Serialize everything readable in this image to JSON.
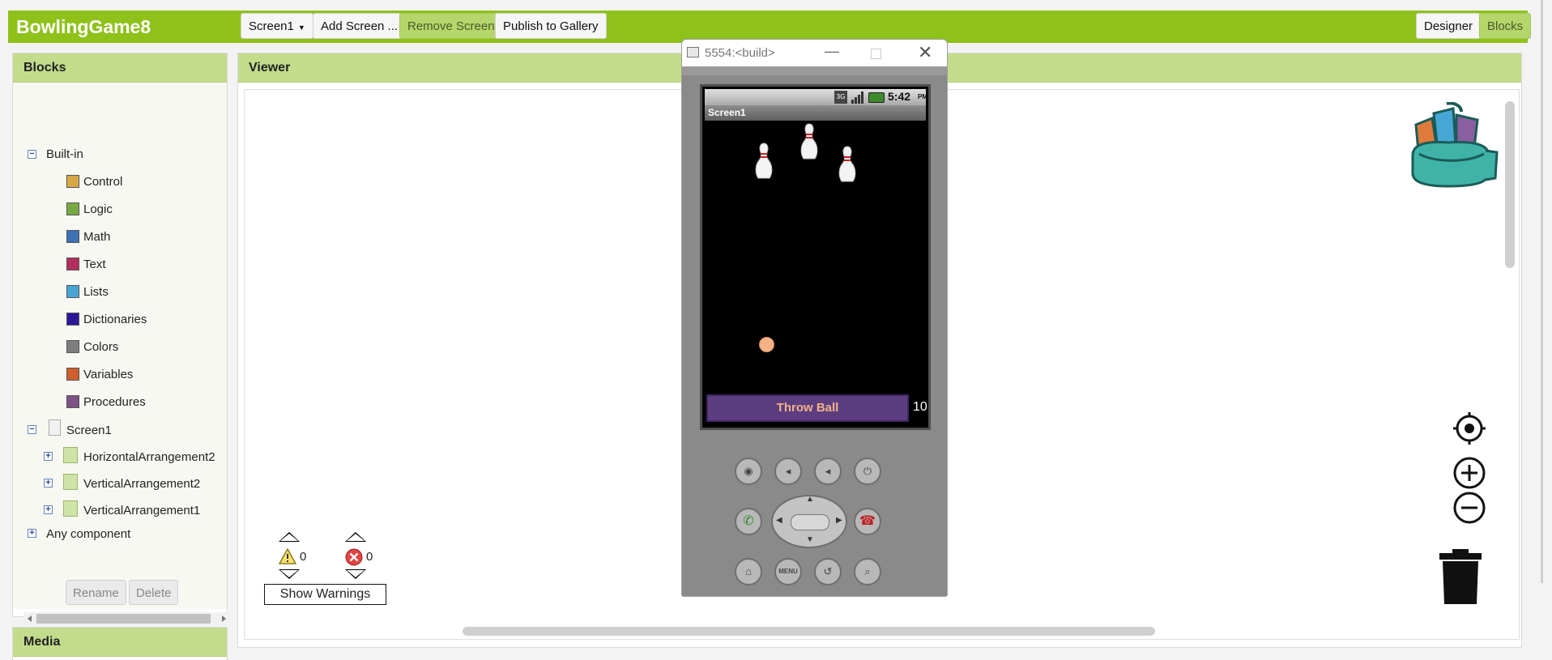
{
  "app": {
    "title": "BowlingGame8"
  },
  "toolbar": {
    "screen_select": "Screen1",
    "add_screen": "Add Screen ...",
    "remove_screen": "Remove Screen",
    "publish": "Publish to Gallery",
    "designer": "Designer",
    "blocks": "Blocks"
  },
  "blocks_panel": {
    "title": "Blocks",
    "builtin_label": "Built-in",
    "builtin": [
      {
        "label": "Control",
        "color": "#d7a745"
      },
      {
        "label": "Logic",
        "color": "#77ab41"
      },
      {
        "label": "Math",
        "color": "#3f71b5"
      },
      {
        "label": "Text",
        "color": "#b32d5e"
      },
      {
        "label": "Lists",
        "color": "#49a6d4"
      },
      {
        "label": "Dictionaries",
        "color": "#2d1799"
      },
      {
        "label": "Colors",
        "color": "#7d7d7d"
      },
      {
        "label": "Variables",
        "color": "#d05f2d"
      },
      {
        "label": "Procedures",
        "color": "#7c5385"
      }
    ],
    "screen_label": "Screen1",
    "components": [
      "HorizontalArrangement2",
      "VerticalArrangement2",
      "VerticalArrangement1"
    ],
    "any_component": "Any component",
    "rename": "Rename",
    "delete": "Delete"
  },
  "media_panel": {
    "title": "Media"
  },
  "viewer": {
    "title": "Viewer",
    "warnings_count": "0",
    "errors_count": "0",
    "show_warnings": "Show Warnings"
  },
  "emulator": {
    "window_title": "5554:<build>",
    "status_time": "5:42",
    "status_ampm": "PM",
    "app_title": "Screen1",
    "throw_button": "Throw Ball",
    "score": "10",
    "menu_key": "MENU"
  }
}
